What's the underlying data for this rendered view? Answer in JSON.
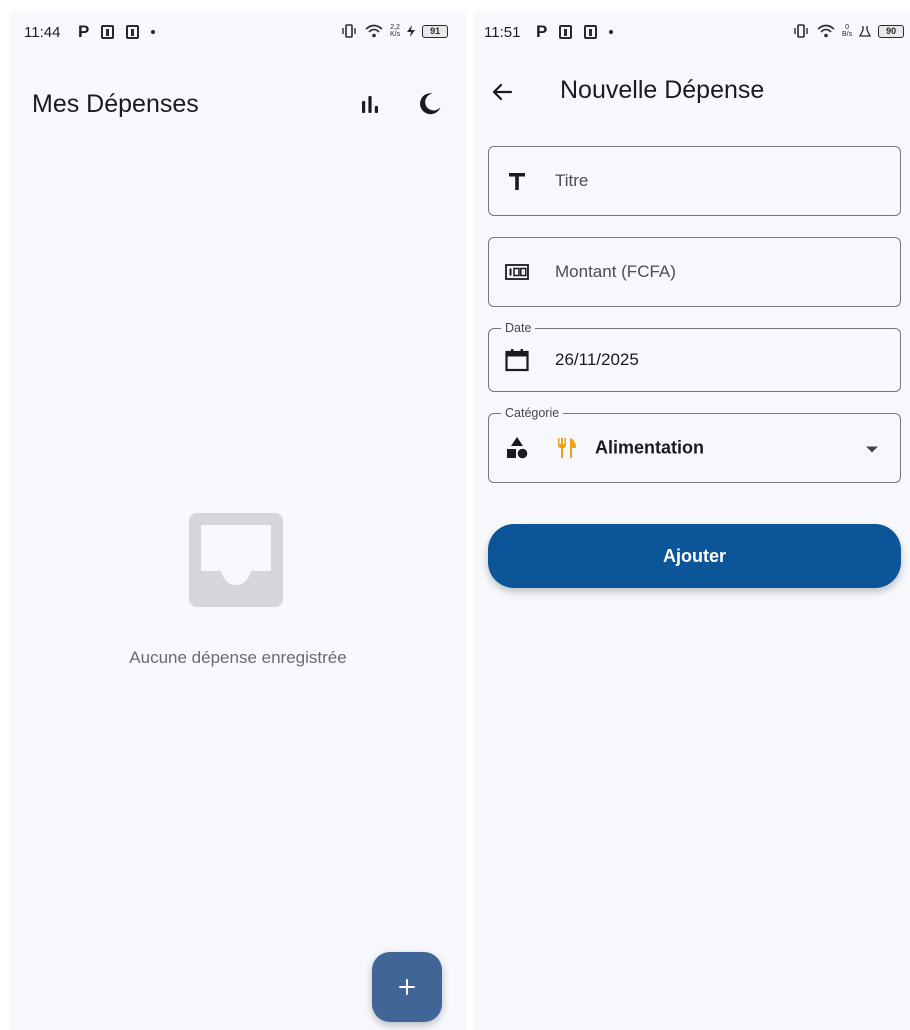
{
  "left_screen": {
    "status_bar": {
      "time": "11:44",
      "app_letter": "P",
      "net_speed_top": "2,2",
      "net_speed_bottom": "K/s",
      "battery": "91"
    },
    "app_bar": {
      "title": "Mes Dépenses",
      "actions": [
        "bar-chart-icon",
        "dark-mode-moon-icon"
      ]
    },
    "empty_state": {
      "icon": "inbox-icon",
      "message": "Aucune dépense enregistrée"
    },
    "fab": {
      "label": "+"
    }
  },
  "right_screen": {
    "status_bar": {
      "time": "11:51",
      "app_letter": "P",
      "net_speed_top": "0",
      "net_speed_bottom": "B/s",
      "battery": "90"
    },
    "app_bar": {
      "back_icon": "arrow-back-icon",
      "title": "Nouvelle Dépense"
    },
    "form": {
      "title_field": {
        "icon": "title-t-icon",
        "placeholder": "Titre",
        "value": ""
      },
      "amount_field": {
        "icon": "money-100-icon",
        "placeholder": "Montant (FCFA)",
        "value": ""
      },
      "date_field": {
        "icon": "calendar-icon",
        "label": "Date",
        "value": "26/11/2025"
      },
      "category_field": {
        "icon": "category-shapes-icon",
        "label": "Catégorie",
        "selected_emoji": "fork-knife-icon",
        "selected_value": "Alimentation"
      },
      "submit_label": "Ajouter"
    }
  },
  "colors": {
    "screen_bg": "#f7f8fc",
    "primary": "#0c5598",
    "fab": "#3f6697",
    "outline": "#73777f",
    "empty_icon": "#d5d6db"
  }
}
